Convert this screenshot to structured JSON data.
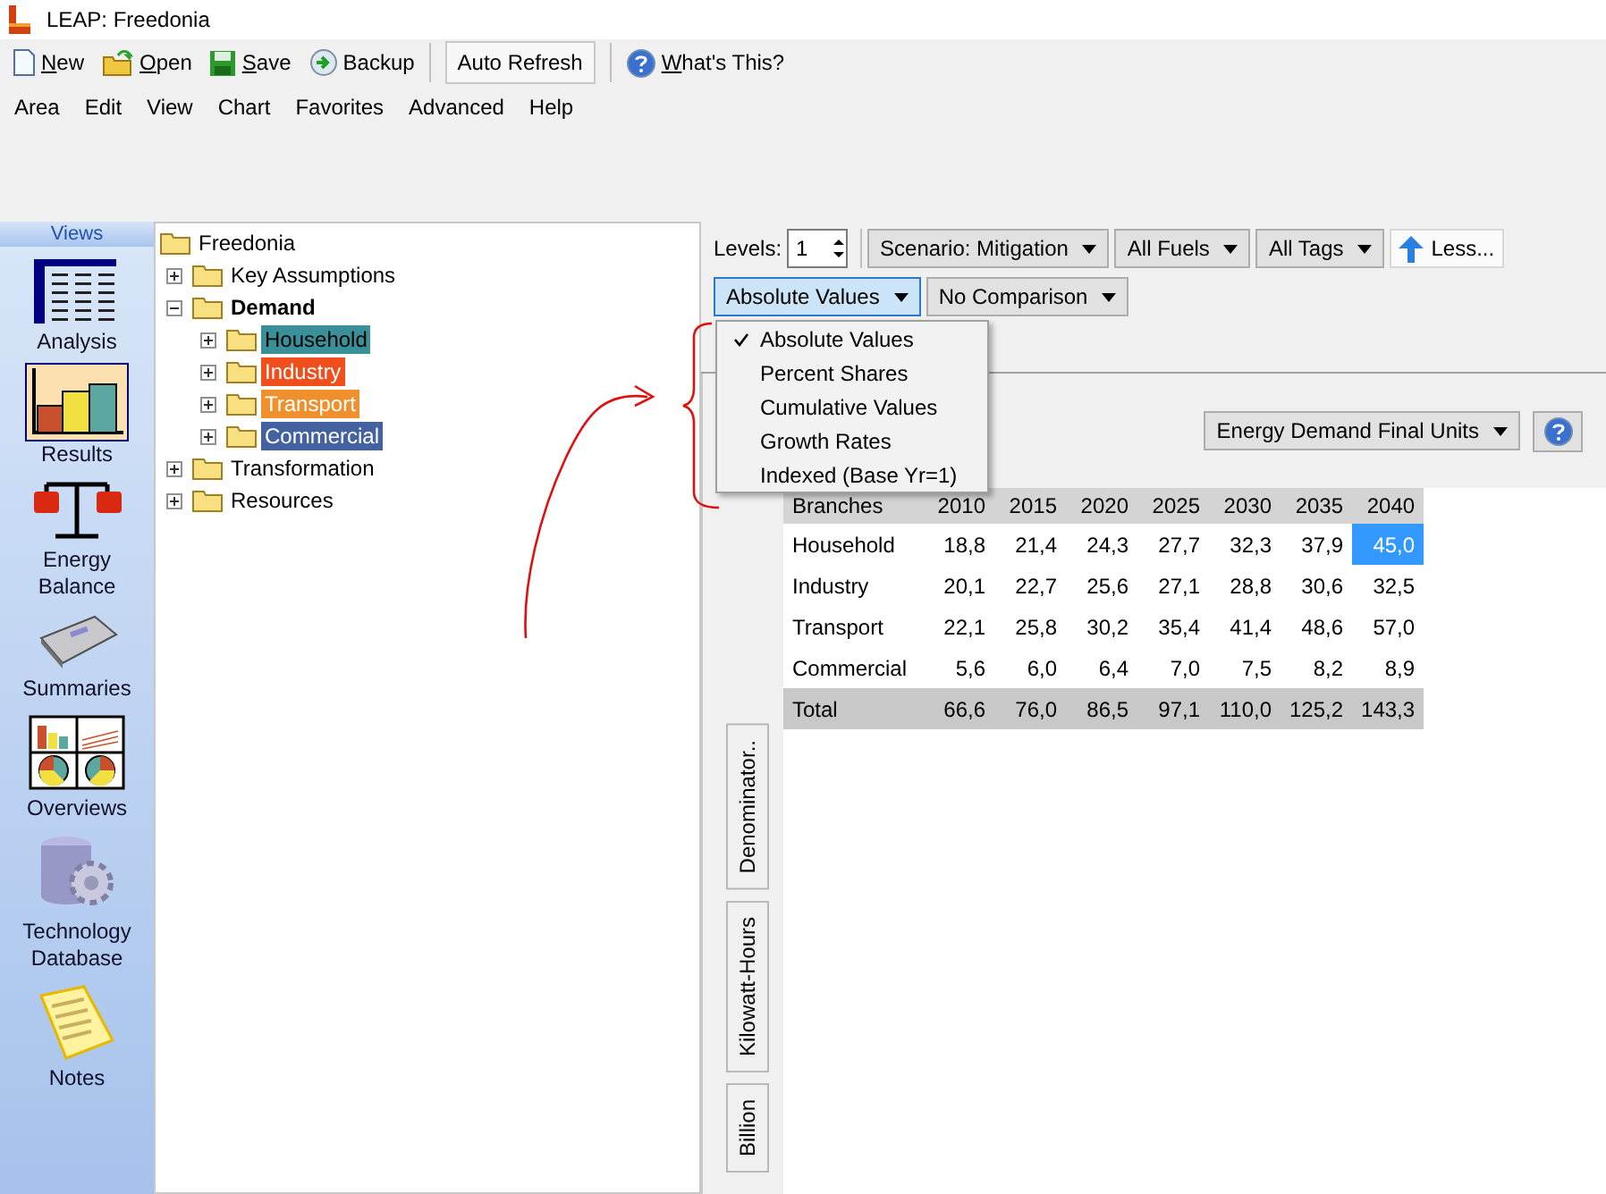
{
  "window": {
    "title": "LEAP: Freedonia"
  },
  "toolbar": [
    {
      "label": "New",
      "kind": "new",
      "underlined": true
    },
    {
      "label": "Open",
      "kind": "open",
      "underlined": true
    },
    {
      "label": "Save",
      "kind": "save",
      "underlined": true
    },
    {
      "label": "Backup",
      "kind": "backup",
      "underlined": false
    },
    {
      "label": "Auto Refresh",
      "kind": "toggle",
      "underlined": false
    },
    {
      "label": "What's This?",
      "kind": "help",
      "underlined": true
    }
  ],
  "menu_bar": [
    "Area",
    "Edit",
    "View",
    "Chart",
    "Favorites",
    "Advanced",
    "Help"
  ],
  "views": {
    "title": "Views",
    "items": [
      {
        "label": "Analysis",
        "kind": "analysis",
        "selected": false
      },
      {
        "label": "Results",
        "kind": "results",
        "selected": true
      },
      {
        "label": "Energy Balance",
        "kind": "balance",
        "selected": false
      },
      {
        "label": "Summaries",
        "kind": "summaries",
        "selected": false
      },
      {
        "label": "Overviews",
        "kind": "overviews",
        "selected": false
      },
      {
        "label": "Technology Database",
        "kind": "database",
        "selected": false
      },
      {
        "label": "Notes",
        "kind": "notes",
        "selected": false
      }
    ]
  },
  "tree": {
    "label": "Freedonia",
    "selected": false,
    "children": [
      {
        "label": "Key Assumptions",
        "expanded": false,
        "selected": false
      },
      {
        "label": "Demand",
        "expanded": true,
        "selected": true,
        "children": [
          {
            "label": "Household",
            "expanded": false,
            "selected": false,
            "color": "#3a9098"
          },
          {
            "label": "Industry",
            "expanded": false,
            "selected": false,
            "color": "#f04e1c"
          },
          {
            "label": "Transport",
            "expanded": false,
            "selected": false,
            "color": "#f0902c"
          },
          {
            "label": "Commercial",
            "expanded": false,
            "selected": false,
            "color": "#4462a0"
          }
        ]
      },
      {
        "label": "Transformation",
        "expanded": false,
        "selected": false
      },
      {
        "label": "Resources",
        "expanded": false,
        "selected": false
      }
    ]
  },
  "filters": {
    "levels_label": "Levels:",
    "levels_value": "1",
    "dropdowns": [
      "Scenario: Mitigation",
      "All Fuels",
      "All Tags"
    ],
    "less_button": "Less..."
  },
  "display": {
    "dropdowns": [
      {
        "label": "Absolute Values",
        "open": true
      },
      {
        "label": "No Comparison",
        "open": false
      }
    ],
    "menu": [
      {
        "label": "Absolute Values",
        "checked": true
      },
      {
        "label": "Percent Shares",
        "checked": false
      },
      {
        "label": "Cumulative Values",
        "checked": false
      },
      {
        "label": "Growth Rates",
        "checked": false
      },
      {
        "label": "Indexed (Base Yr=1)",
        "checked": false
      }
    ]
  },
  "units": {
    "dropdown": "Energy Demand Final Units"
  },
  "side_tabs": [
    "Denominator..",
    "Kilowatt-Hours",
    "Billion"
  ],
  "table": {
    "columns": [
      "Branches",
      "2010",
      "2015",
      "2020",
      "2025",
      "2030",
      "2035",
      "2040"
    ],
    "rows": [
      {
        "kind": "branch",
        "cells": [
          {
            "text": "Household",
            "selected": false
          },
          {
            "text": "18,8",
            "selected": false
          },
          {
            "text": "21,4",
            "selected": false
          },
          {
            "text": "24,3",
            "selected": false
          },
          {
            "text": "27,7",
            "selected": false
          },
          {
            "text": "32,3",
            "selected": false
          },
          {
            "text": "37,9",
            "selected": false
          },
          {
            "text": "45,0",
            "selected": true
          }
        ]
      },
      {
        "kind": "branch",
        "cells": [
          {
            "text": "Industry",
            "selected": false
          },
          {
            "text": "20,1",
            "selected": false
          },
          {
            "text": "22,7",
            "selected": false
          },
          {
            "text": "25,6",
            "selected": false
          },
          {
            "text": "27,1",
            "selected": false
          },
          {
            "text": "28,8",
            "selected": false
          },
          {
            "text": "30,6",
            "selected": false
          },
          {
            "text": "32,5",
            "selected": false
          }
        ]
      },
      {
        "kind": "branch",
        "cells": [
          {
            "text": "Transport",
            "selected": false
          },
          {
            "text": "22,1",
            "selected": false
          },
          {
            "text": "25,8",
            "selected": false
          },
          {
            "text": "30,2",
            "selected": false
          },
          {
            "text": "35,4",
            "selected": false
          },
          {
            "text": "41,4",
            "selected": false
          },
          {
            "text": "48,6",
            "selected": false
          },
          {
            "text": "57,0",
            "selected": false
          }
        ]
      },
      {
        "kind": "branch",
        "cells": [
          {
            "text": "Commercial",
            "selected": false
          },
          {
            "text": "5,6",
            "selected": false
          },
          {
            "text": "6,0",
            "selected": false
          },
          {
            "text": "6,4",
            "selected": false
          },
          {
            "text": "7,0",
            "selected": false
          },
          {
            "text": "7,5",
            "selected": false
          },
          {
            "text": "8,2",
            "selected": false
          },
          {
            "text": "8,9",
            "selected": false
          }
        ]
      },
      {
        "kind": "total",
        "cells": [
          {
            "text": "Total",
            "selected": false
          },
          {
            "text": "66,6",
            "selected": false
          },
          {
            "text": "76,0",
            "selected": false
          },
          {
            "text": "86,5",
            "selected": false
          },
          {
            "text": "97,1",
            "selected": false
          },
          {
            "text": "110,0",
            "selected": false
          },
          {
            "text": "125,2",
            "selected": false
          },
          {
            "text": "143,3",
            "selected": false
          }
        ]
      }
    ]
  }
}
